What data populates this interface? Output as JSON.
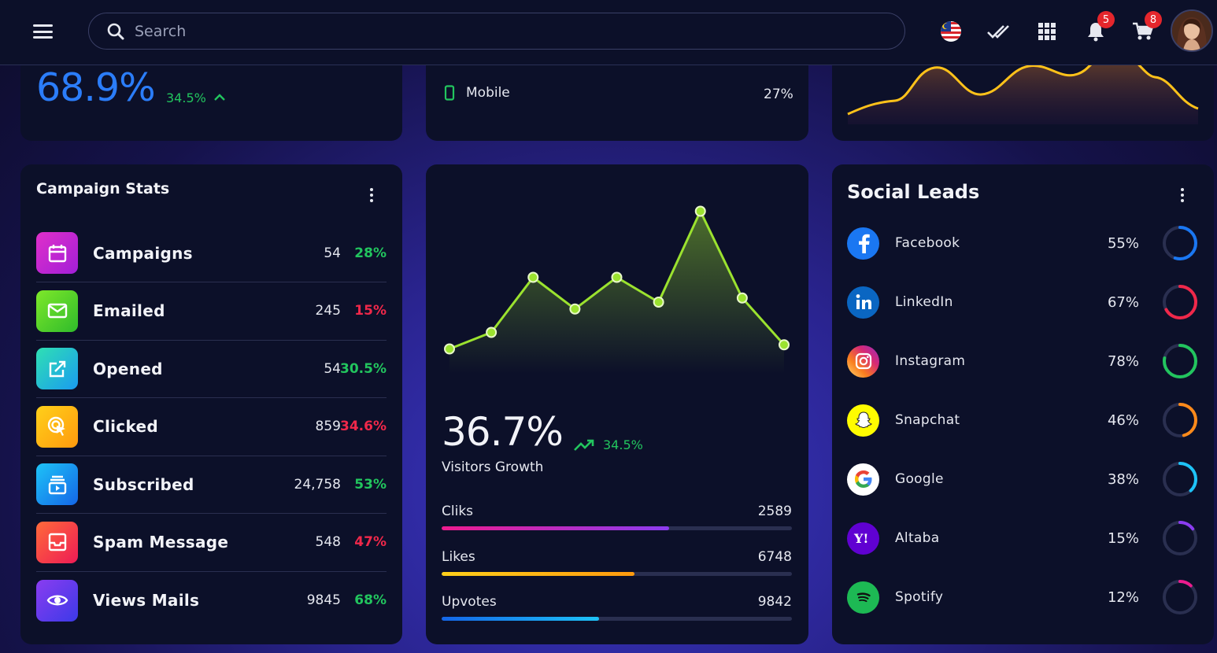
{
  "search": {
    "placeholder": "Search"
  },
  "header": {
    "notifications_count": "5",
    "cart_count": "8"
  },
  "top_cards": {
    "conversion": {
      "value": "68.9%",
      "change": "34.5%"
    },
    "devices": {
      "label": "Mobile",
      "value": "27%"
    }
  },
  "campaign": {
    "title": "Campaign Stats",
    "items": [
      {
        "label": "Campaigns",
        "count": "54",
        "pct": "28%",
        "trend": "pos",
        "icon": "calendar-icon",
        "color": [
          "#e02fc9",
          "#a21fd8"
        ]
      },
      {
        "label": "Emailed",
        "count": "245",
        "pct": "15%",
        "trend": "neg",
        "icon": "mail-icon",
        "color": [
          "#7ee82a",
          "#2fbb2b"
        ]
      },
      {
        "label": "Opened",
        "count": "54",
        "pct": "30.5%",
        "trend": "pos",
        "icon": "external-link-icon",
        "color": [
          "#2fe0b3",
          "#1a9bf0"
        ]
      },
      {
        "label": "Clicked",
        "count": "859",
        "pct": "34.6%",
        "trend": "neg",
        "icon": "cursor-click-icon",
        "color": [
          "#ffd01a",
          "#ff9a0e"
        ]
      },
      {
        "label": "Subscribed",
        "count": "24,758",
        "pct": "53%",
        "trend": "pos",
        "icon": "subscription-icon",
        "color": [
          "#1ec3f7",
          "#1466e8"
        ]
      },
      {
        "label": "Spam Message",
        "count": "548",
        "pct": "47%",
        "trend": "neg",
        "icon": "inbox-icon",
        "color": [
          "#ff6a3a",
          "#ee1b55"
        ]
      },
      {
        "label": "Views Mails",
        "count": "9845",
        "pct": "68%",
        "trend": "pos",
        "icon": "eye-icon",
        "color": [
          "#8a3cf0",
          "#3c3ae8"
        ]
      }
    ]
  },
  "visitors": {
    "value": "36.7%",
    "change": "34.5%",
    "label": "Visitors Growth",
    "bars": [
      {
        "label": "Cliks",
        "value": "2589",
        "progress": 0.65,
        "color": [
          "#ee1b8e",
          "#8b3cf0"
        ]
      },
      {
        "label": "Likes",
        "value": "6748",
        "progress": 0.55,
        "color": [
          "#ffd01a",
          "#ff9a0e"
        ]
      },
      {
        "label": "Upvotes",
        "value": "9842",
        "progress": 0.45,
        "color": [
          "#1466e8",
          "#1ec3f7"
        ]
      }
    ]
  },
  "chart_data": {
    "type": "area",
    "title": "",
    "values": [
      18,
      30,
      70,
      47,
      70,
      52,
      118,
      55,
      21
    ],
    "color": "#9be22f"
  },
  "social": {
    "title": "Social Leads",
    "items": [
      {
        "name": "Facebook",
        "pct": "55%",
        "ratio": 0.55,
        "ring_color": "#1a77f2",
        "icon": "facebook-icon"
      },
      {
        "name": "LinkedIn",
        "pct": "67%",
        "ratio": 0.67,
        "ring_color": "#f0284a",
        "icon": "linkedin-icon"
      },
      {
        "name": "Instagram",
        "pct": "78%",
        "ratio": 0.78,
        "ring_color": "#22c55e",
        "icon": "instagram-icon"
      },
      {
        "name": "Snapchat",
        "pct": "46%",
        "ratio": 0.46,
        "ring_color": "#ff8a1a",
        "icon": "snapchat-icon"
      },
      {
        "name": "Google",
        "pct": "38%",
        "ratio": 0.38,
        "ring_color": "#1ec3f7",
        "icon": "google-icon"
      },
      {
        "name": "Altaba",
        "pct": "15%",
        "ratio": 0.15,
        "ring_color": "#8b3cf0",
        "icon": "altaba-icon"
      },
      {
        "name": "Spotify",
        "pct": "12%",
        "ratio": 0.12,
        "ring_color": "#ee1b8e",
        "icon": "spotify-icon"
      }
    ]
  }
}
